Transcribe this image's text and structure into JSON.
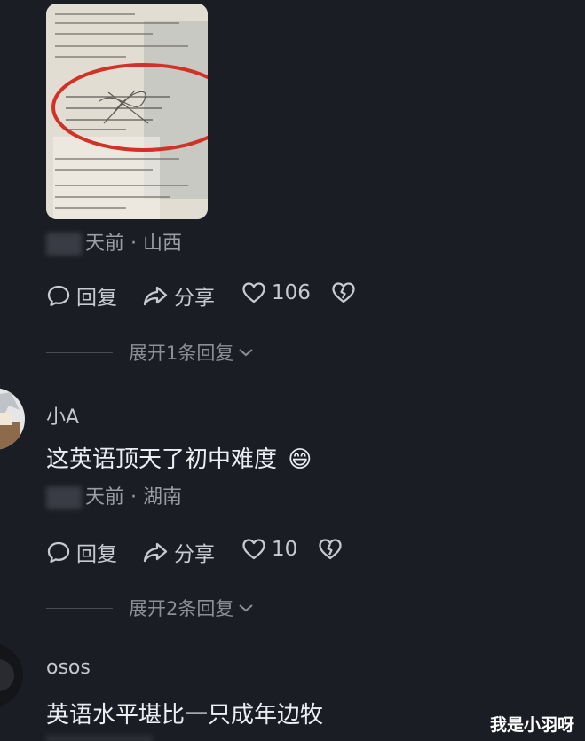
{
  "comments": [
    {
      "location": "天前 · 山西",
      "actions": {
        "reply": "回复",
        "share": "分享",
        "likes": "106"
      },
      "expand_label": "展开1条回复"
    },
    {
      "username": "小A",
      "text": "这英语顶天了初中难度",
      "emoji": "😄",
      "location": "天前 · 湖南",
      "actions": {
        "reply": "回复",
        "share": "分享",
        "likes": "10"
      },
      "expand_label": "展开2条回复"
    },
    {
      "username": "osos",
      "text": "英语水平堪比一只成年边牧"
    }
  ],
  "watermark": "我是小羽呀",
  "icons": {
    "reply": "reply-bubble-icon",
    "share": "share-arrow-icon",
    "like": "heart-icon",
    "dislike": "broken-heart-icon",
    "expand": "chevron-down-icon"
  }
}
